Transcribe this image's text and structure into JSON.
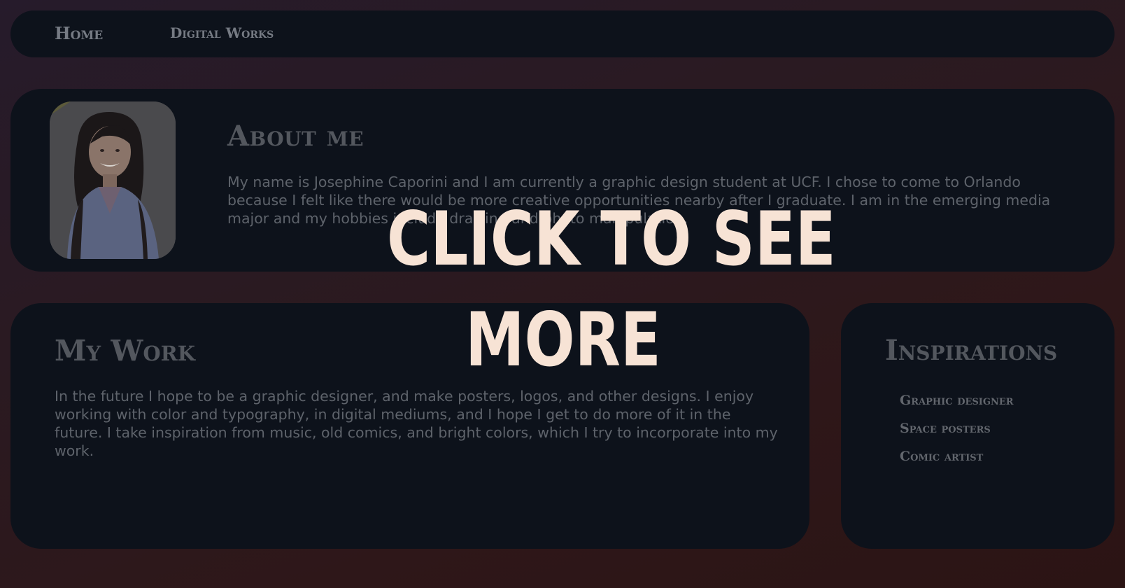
{
  "nav": {
    "home_label": "Home",
    "works_label": "Digital Works"
  },
  "about": {
    "title": "About me",
    "text": "My name is Josephine Caporini and I am currently a graphic design student at UCF. I chose to come to Orlando because I felt like there would be more creative opportunities nearby after I graduate. I am in the emerging media major and my hobbies include drawing and photo manipulation."
  },
  "work": {
    "title": "My Work",
    "text": "In the future I hope to be a graphic designer, and make posters, logos, and other designs. I enjoy working with color and typography, in digital mediums, and I hope I get to do more of it in the future. I take inspiration from music, old comics, and bright colors, which I try to incorporate into my work."
  },
  "inspirations": {
    "title": "Inspirations",
    "items": [
      "Graphic designer",
      "Space posters",
      "Comic artist"
    ]
  },
  "overlay": {
    "line1": "CLICK TO SEE",
    "line2": "MORE"
  },
  "colors": {
    "background": "#2b1a22",
    "panel": "#0d121b",
    "muted_text": "#5e636b",
    "overlay_text": "#f7e3d5"
  }
}
